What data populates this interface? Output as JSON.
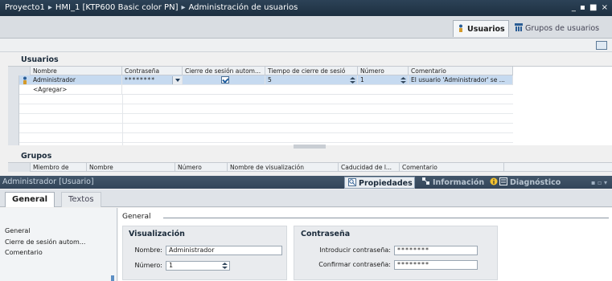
{
  "window": {
    "breadcrumb": [
      "Proyecto1",
      "HMI_1 [KTP600 Basic color PN]",
      "Administración de usuarios"
    ],
    "controls": "_ ▪ ■ ×"
  },
  "tabs": [
    {
      "label": "Usuarios",
      "icon": "user-icon",
      "active": true
    },
    {
      "label": "Grupos de usuarios",
      "icon": "group-icon",
      "active": false
    }
  ],
  "users": {
    "title": "Usuarios",
    "columns": [
      "Nombre",
      "Contraseña",
      "Cierre de sesión autom...",
      "Tiempo de cierre de sesió",
      "Número",
      "Comentario"
    ],
    "rows": [
      {
        "name": "Administrador",
        "password": "********",
        "auto_logoff": true,
        "logoff_time": "5",
        "number": "1",
        "comment": "El usuario 'Administrador' se ..."
      }
    ],
    "add_label": "<Agregar>"
  },
  "groups": {
    "title": "Grupos",
    "columns": [
      "Miembro de",
      "Nombre",
      "Número",
      "Nombre de visualización",
      "Caducidad de l...",
      "Comentario"
    ]
  },
  "inspector": {
    "title": "Administrador [Usuario]",
    "tabs": [
      "Propiedades",
      "Información",
      "Diagnóstico"
    ],
    "subtabs": [
      "General",
      "Textos"
    ],
    "nav": [
      "General",
      "Cierre de sesión autom...",
      "Comentario"
    ],
    "section": "General",
    "visualizacion": {
      "title": "Visualización",
      "name_label": "Nombre:",
      "name_value": "Administrador",
      "number_label": "Número:",
      "number_value": "1"
    },
    "password": {
      "title": "Contraseña",
      "enter_label": "Introducir contraseña:",
      "enter_value": "********",
      "confirm_label": "Confirmar contraseña:",
      "confirm_value": "********"
    }
  },
  "colors": {
    "titlebar": "#2c4257",
    "selection": "#c6daf0",
    "inspector_bar": "#3c4f63"
  }
}
